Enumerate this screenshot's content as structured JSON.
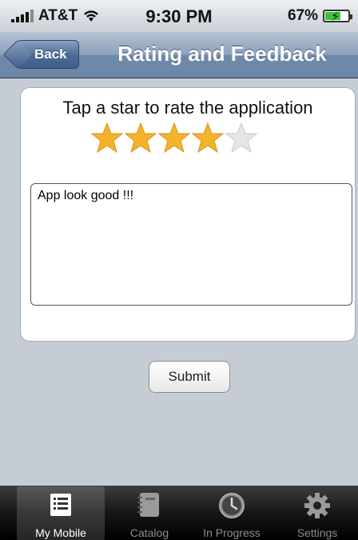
{
  "status_bar": {
    "carrier": "AT&T",
    "time": "9:30 PM",
    "battery": "67%",
    "battery_level": 0.67
  },
  "nav_bar": {
    "back_label": "Back",
    "title": "Rating and Feedback"
  },
  "rating": {
    "prompt": "Tap a star to rate the application",
    "stars_total": 5,
    "stars_filled": 4,
    "filled_color": "#f4b32a",
    "empty_color": "#e6e6e6"
  },
  "feedback": {
    "text": "App look good !!!"
  },
  "submit_label": "Submit",
  "tabs": [
    {
      "label": "My Mobile",
      "icon": "list-icon",
      "active": true
    },
    {
      "label": "Catalog",
      "icon": "notebook-icon",
      "active": false
    },
    {
      "label": "In Progress",
      "icon": "clock-icon",
      "active": false
    },
    {
      "label": "Settings",
      "icon": "gear-icon",
      "active": false
    }
  ]
}
